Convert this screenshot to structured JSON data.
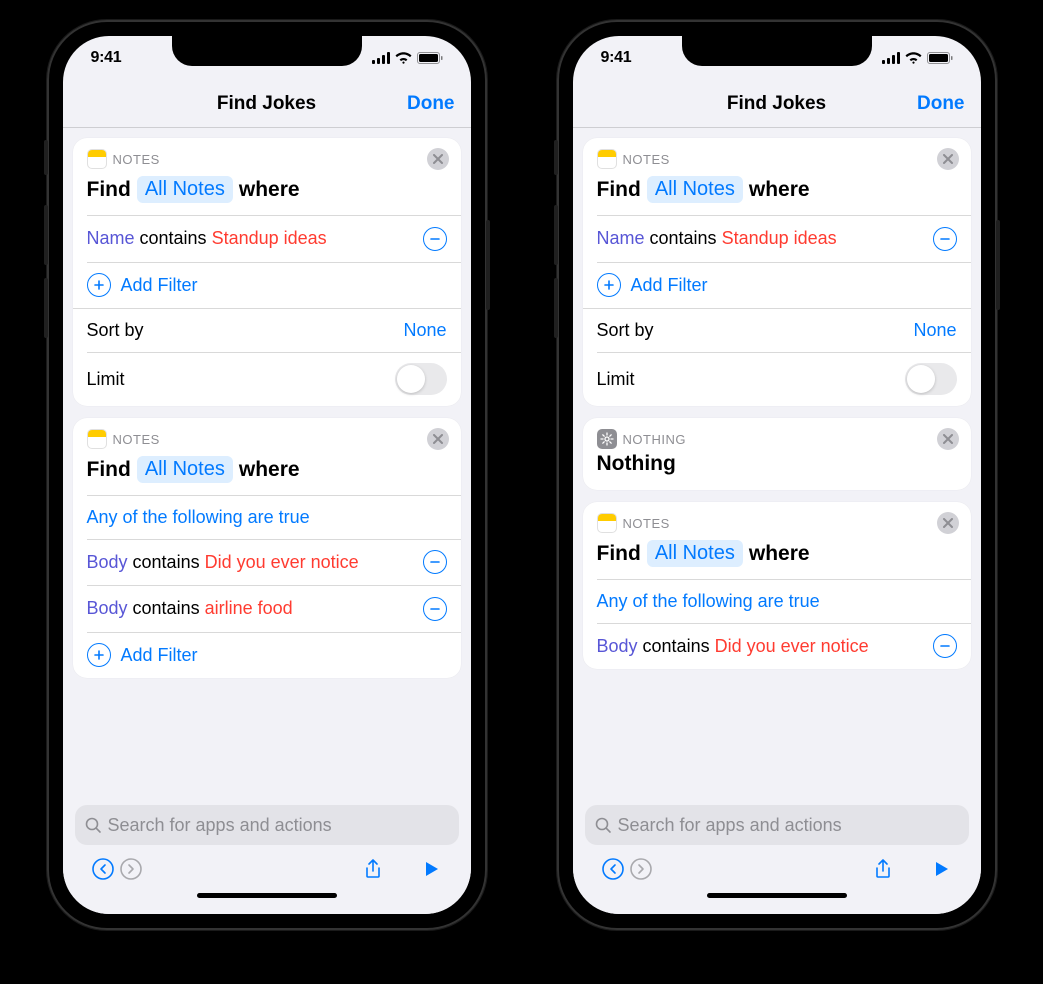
{
  "status": {
    "time": "9:41"
  },
  "nav": {
    "title": "Find Jokes",
    "done": "Done"
  },
  "left": {
    "card1": {
      "app": "NOTES",
      "find": "Find",
      "scope": "All Notes",
      "where": "where",
      "filters": [
        {
          "attr": "Name",
          "op": "contains",
          "val": "Standup ideas"
        }
      ],
      "addFilter": "Add Filter",
      "sortBy": "Sort by",
      "sortValue": "None",
      "limit": "Limit"
    },
    "card2": {
      "app": "NOTES",
      "find": "Find",
      "scope": "All Notes",
      "where": "where",
      "anyTrue": "Any of the following are true",
      "filters": [
        {
          "attr": "Body",
          "op": "contains",
          "val": "Did you ever notice"
        },
        {
          "attr": "Body",
          "op": "contains",
          "val": "airline food"
        }
      ],
      "addFilter": "Add Filter"
    }
  },
  "right": {
    "card1": {
      "app": "NOTES",
      "find": "Find",
      "scope": "All Notes",
      "where": "where",
      "filters": [
        {
          "attr": "Name",
          "op": "contains",
          "val": "Standup ideas"
        }
      ],
      "addFilter": "Add Filter",
      "sortBy": "Sort by",
      "sortValue": "None",
      "limit": "Limit"
    },
    "nothing": {
      "app": "NOTHING",
      "title": "Nothing"
    },
    "card2": {
      "app": "NOTES",
      "find": "Find",
      "scope": "All Notes",
      "where": "where",
      "anyTrue": "Any of the following are true",
      "filters": [
        {
          "attr": "Body",
          "op": "contains",
          "val": "Did you ever notice"
        }
      ]
    }
  },
  "search": {
    "placeholder": "Search for apps and actions"
  }
}
